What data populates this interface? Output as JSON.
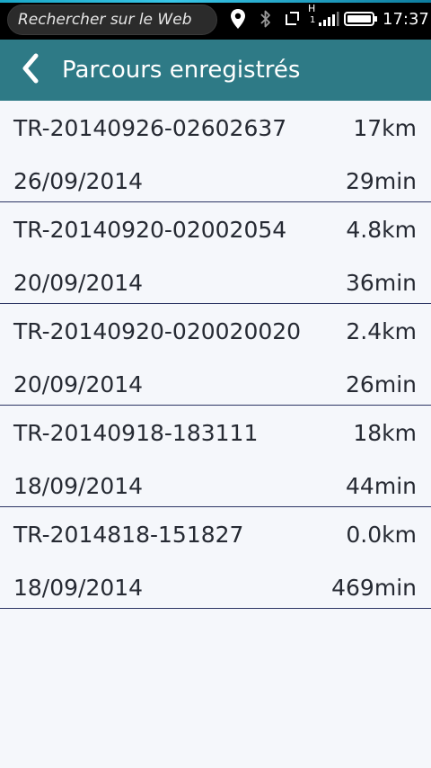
{
  "status_bar": {
    "search_placeholder": "Rechercher sur le Web",
    "network_type": "H",
    "sim_slot": "1",
    "time": "17:37",
    "icons": [
      "location-icon",
      "bluetooth-icon",
      "screen-rotation-icon",
      "signal-icon",
      "battery-icon"
    ]
  },
  "header": {
    "back_icon": "chevron-left-icon",
    "title": "Parcours enregistrés",
    "color": "#2e7a86"
  },
  "tracks": [
    {
      "name": "TR-20140926-02602637",
      "distance": "17km",
      "date": "26/09/2014",
      "duration": "29min"
    },
    {
      "name": "TR-20140920-02002054",
      "distance": "4.8km",
      "date": "20/09/2014",
      "duration": "36min"
    },
    {
      "name": "TR-20140920-020020020",
      "distance": "2.4km",
      "date": "20/09/2014",
      "duration": "26min"
    },
    {
      "name": "TR-20140918-183111",
      "distance": "18km",
      "date": "18/09/2014",
      "duration": "44min"
    },
    {
      "name": "TR-2014818-151827",
      "distance": "0.0km",
      "date": "18/09/2014",
      "duration": "469min"
    }
  ]
}
